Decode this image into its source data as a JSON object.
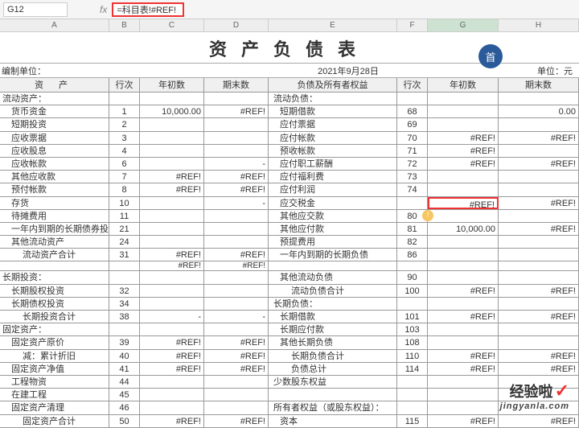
{
  "formula": {
    "cell_ref": "G12",
    "fx": "fx",
    "value": "=科目表!#REF!"
  },
  "cols": {
    "A": "A",
    "B": "B",
    "C": "C",
    "D": "D",
    "E": "E",
    "F": "F",
    "G": "G",
    "H": "H"
  },
  "title": "资产负债表",
  "meta": {
    "unit_label": "编制单位：",
    "date": "2021年9月28日",
    "currency": "单位：元",
    "badge": "首"
  },
  "hdr": {
    "assets": "资  产",
    "row": "行次",
    "begin": "年初数",
    "end": "期末数",
    "liab": "负债及所有者权益"
  },
  "rows": [
    {
      "a": "流动资产：",
      "b": "",
      "c": "",
      "d": "",
      "e": "流动负债：",
      "f": "",
      "g": "",
      "h": "",
      "ai": 0,
      "ei": 0
    },
    {
      "a": "货币资金",
      "b": "1",
      "c": "10,000.00",
      "d": "#REF!",
      "e": "短期借款",
      "f": "68",
      "g": "",
      "h": "0.00",
      "ai": 1,
      "ei": 1
    },
    {
      "a": "短期投资",
      "b": "2",
      "c": "",
      "d": "",
      "e": "应付票据",
      "f": "69",
      "g": "",
      "h": "",
      "ai": 1,
      "ei": 1
    },
    {
      "a": "应收票据",
      "b": "3",
      "c": "",
      "d": "",
      "e": "应付帐款",
      "f": "70",
      "g": "#REF!",
      "h": "#REF!",
      "ai": 1,
      "ei": 1
    },
    {
      "a": "应收股息",
      "b": "4",
      "c": "",
      "d": "",
      "e": "预收帐款",
      "f": "71",
      "g": "#REF!",
      "h": "",
      "ai": 1,
      "ei": 1
    },
    {
      "a": "应收帐款",
      "b": "6",
      "c": "",
      "d": "-",
      "e": "应付职工薪酬",
      "f": "72",
      "g": "#REF!",
      "h": "#REF!",
      "ai": 1,
      "ei": 1
    },
    {
      "a": "其他应收款",
      "b": "7",
      "c": "#REF!",
      "d": "#REF!",
      "e": "应付福利费",
      "f": "73",
      "g": "",
      "h": "",
      "ai": 1,
      "ei": 1
    },
    {
      "a": "预付帐款",
      "b": "8",
      "c": "#REF!",
      "d": "#REF!",
      "e": "应付利润",
      "f": "74",
      "g": "",
      "h": "",
      "ai": 1,
      "ei": 1
    },
    {
      "a": "存货",
      "b": "10",
      "c": "",
      "d": "-",
      "e": "应交税金",
      "f": "",
      "g": "#REF!",
      "h": "#REF!",
      "ai": 1,
      "ei": 1,
      "hl": true
    },
    {
      "a": "待摊费用",
      "b": "11",
      "c": "",
      "d": "",
      "e": "其他应交款",
      "f": "80",
      "g": "",
      "h": "",
      "ai": 1,
      "ei": 1
    },
    {
      "a": "一年内到期的长期债券投资",
      "b": "21",
      "c": "",
      "d": "",
      "e": "其他应付款",
      "f": "81",
      "g": "10,000.00",
      "h": "#REF!",
      "ai": 1,
      "ei": 1
    },
    {
      "a": "其他流动资产",
      "b": "24",
      "c": "",
      "d": "",
      "e": "预提费用",
      "f": "82",
      "g": "",
      "h": "",
      "ai": 1,
      "ei": 1
    },
    {
      "a": "流动资产合计",
      "b": "31",
      "c": "#REF!",
      "d": "#REF!",
      "e": "一年内到期的长期负债",
      "f": "86",
      "g": "",
      "h": "",
      "ai": 2,
      "ei": 1,
      "sub": "#REF!"
    },
    {
      "a": "长期投资：",
      "b": "",
      "c": "",
      "d": "",
      "e": "其他流动负债",
      "f": "90",
      "g": "",
      "h": "",
      "ai": 0,
      "ei": 1
    },
    {
      "a": "长期股权投资",
      "b": "32",
      "c": "",
      "d": "",
      "e": "流动负债合计",
      "f": "100",
      "g": "#REF!",
      "h": "#REF!",
      "ai": 1,
      "ei": 2
    },
    {
      "a": "长期债权投资",
      "b": "34",
      "c": "",
      "d": "",
      "e": "长期负债：",
      "f": "",
      "g": "",
      "h": "",
      "ai": 1,
      "ei": 0
    },
    {
      "a": "长期投资合计",
      "b": "38",
      "c": "-",
      "d": "-",
      "e": "长期借款",
      "f": "101",
      "g": "#REF!",
      "h": "#REF!",
      "ai": 2,
      "ei": 1
    },
    {
      "a": "固定资产：",
      "b": "",
      "c": "",
      "d": "",
      "e": "长期应付款",
      "f": "103",
      "g": "",
      "h": "",
      "ai": 0,
      "ei": 1
    },
    {
      "a": "固定资产原价",
      "b": "39",
      "c": "#REF!",
      "d": "#REF!",
      "e": "其他长期负债",
      "f": "108",
      "g": "",
      "h": "",
      "ai": 1,
      "ei": 1
    },
    {
      "a": "减：累计折旧",
      "b": "40",
      "c": "#REF!",
      "d": "#REF!",
      "e": "长期负债合计",
      "f": "110",
      "g": "#REF!",
      "h": "#REF!",
      "ai": 2,
      "ei": 2
    },
    {
      "a": "固定资产净值",
      "b": "41",
      "c": "#REF!",
      "d": "#REF!",
      "e": "负债总计",
      "f": "114",
      "g": "#REF!",
      "h": "#REF!",
      "ai": 1,
      "ei": 2
    },
    {
      "a": "工程物资",
      "b": "44",
      "c": "",
      "d": "",
      "e": "少数股东权益",
      "f": "",
      "g": "",
      "h": "",
      "ai": 1,
      "ei": 0
    },
    {
      "a": "在建工程",
      "b": "45",
      "c": "",
      "d": "",
      "e": "",
      "f": "",
      "g": "",
      "h": "",
      "ai": 1,
      "ei": 0
    },
    {
      "a": "固定资产清理",
      "b": "46",
      "c": "",
      "d": "",
      "e": "所有者权益（或股东权益）：",
      "f": "",
      "g": "",
      "h": "",
      "ai": 1,
      "ei": 0
    },
    {
      "a": "固定资产合计",
      "b": "50",
      "c": "#REF!",
      "d": "#REF!",
      "e": "资本",
      "f": "115",
      "g": "#REF!",
      "h": "#REF!",
      "ai": 2,
      "ei": 1
    }
  ],
  "watermark": {
    "line1": "经验啦",
    "check": "✓",
    "line2": "jingyanla.com"
  }
}
